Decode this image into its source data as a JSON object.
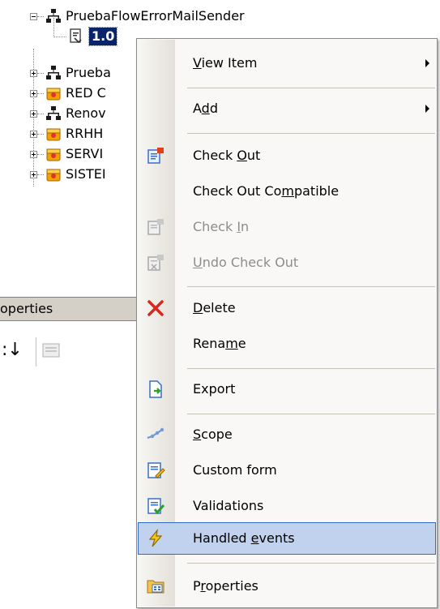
{
  "tree": {
    "nodes": [
      {
        "label": "PruebaFlowErrorMailSender",
        "expanded": true
      },
      {
        "label": "1.0",
        "selected": true
      },
      {
        "label": "Prueba"
      },
      {
        "label": "RED C"
      },
      {
        "label": "Renov"
      },
      {
        "label": "RRHH"
      },
      {
        "label": "SERVI"
      },
      {
        "label": "SISTEI"
      }
    ]
  },
  "properties": {
    "header_label": "operties"
  },
  "menu": {
    "items": [
      {
        "pre": "",
        "ul": "V",
        "post": "iew Item",
        "submenu": true,
        "icon": ""
      },
      {
        "pre": "A",
        "ul": "d",
        "post": "d",
        "submenu": true,
        "icon": ""
      },
      {
        "pre": "Check ",
        "ul": "O",
        "post": "ut",
        "icon": "check-out-icon"
      },
      {
        "pre": "Check Out Co",
        "ul": "m",
        "post": "patible",
        "icon": ""
      },
      {
        "pre": "Check ",
        "ul": "I",
        "post": "n",
        "icon": "check-in-icon",
        "disabled": true
      },
      {
        "pre": "",
        "ul": "U",
        "post": "ndo Check Out",
        "icon": "undo-check-out-icon",
        "disabled": true
      },
      {
        "pre": "",
        "ul": "D",
        "post": "elete",
        "icon": "delete-icon"
      },
      {
        "pre": "Rena",
        "ul": "m",
        "post": "e",
        "icon": ""
      },
      {
        "pre": "Export",
        "ul": "",
        "post": "",
        "icon": "export-icon"
      },
      {
        "pre": "",
        "ul": "S",
        "post": "cope",
        "icon": "scope-icon"
      },
      {
        "pre": "Custom form",
        "ul": "",
        "post": "",
        "icon": "custom-form-icon"
      },
      {
        "pre": "Validations",
        "ul": "",
        "post": "",
        "icon": "validations-icon"
      },
      {
        "pre": "Handled ",
        "ul": "e",
        "post": "vents",
        "icon": "handled-events-icon",
        "highlighted": true
      },
      {
        "pre": "P",
        "ul": "r",
        "post": "operties",
        "icon": "properties-icon"
      }
    ]
  },
  "colors": {
    "selection": "#0a246a",
    "highlight": "#c1d2ee",
    "highlight_border": "#316ac5",
    "delete_red": "#d9281e",
    "folder_orange": "#f2a100"
  }
}
